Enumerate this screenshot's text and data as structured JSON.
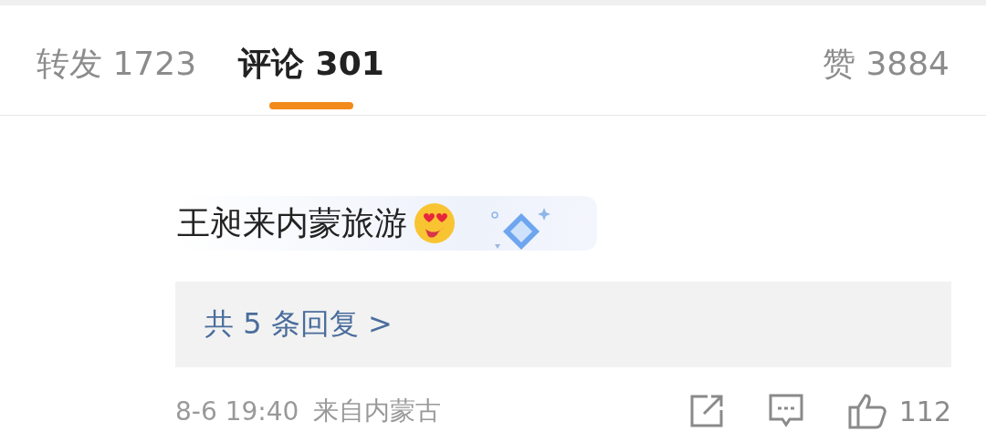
{
  "tabs": [
    {
      "label": "转发 1723",
      "selected": false
    },
    {
      "label": "评论 301",
      "selected": true
    },
    {
      "label": "赞 3884",
      "selected": false
    }
  ],
  "comment": {
    "text": "王昶来内蒙旅游",
    "replies_link": "共 5 条回复 >",
    "time": "8-6 19:40",
    "source": "来自内蒙古",
    "like_count": "112"
  }
}
